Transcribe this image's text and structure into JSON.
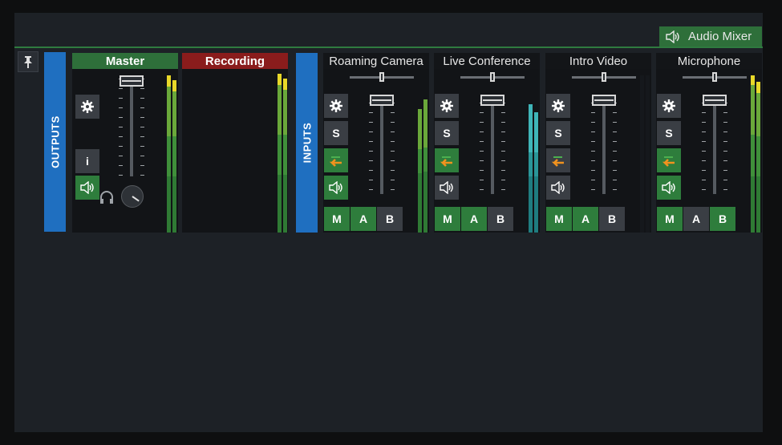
{
  "tab": {
    "label": "Audio Mixer"
  },
  "outputs_label": "OUTPUTS",
  "inputs_label": "INPUTS",
  "outputs": [
    {
      "title": "Master",
      "info_label": "i"
    },
    {
      "title": "Recording"
    }
  ],
  "inputs": [
    {
      "title": "Roaming Camera",
      "solo_label": "S",
      "bus": {
        "m": "M",
        "a": "A",
        "b": "B"
      }
    },
    {
      "title": "Live Conference",
      "solo_label": "S",
      "bus": {
        "m": "M",
        "a": "A",
        "b": "B"
      }
    },
    {
      "title": "Intro Video",
      "solo_label": "S",
      "bus": {
        "m": "M",
        "a": "A",
        "b": "B"
      }
    },
    {
      "title": "Microphone",
      "solo_label": "S",
      "bus": {
        "m": "M",
        "a": "A",
        "b": "B"
      }
    }
  ],
  "colors": {
    "green": "#2e7d3c",
    "blue": "#1f6fc0",
    "red": "#8a1c1c",
    "orange": "#f0921e"
  }
}
